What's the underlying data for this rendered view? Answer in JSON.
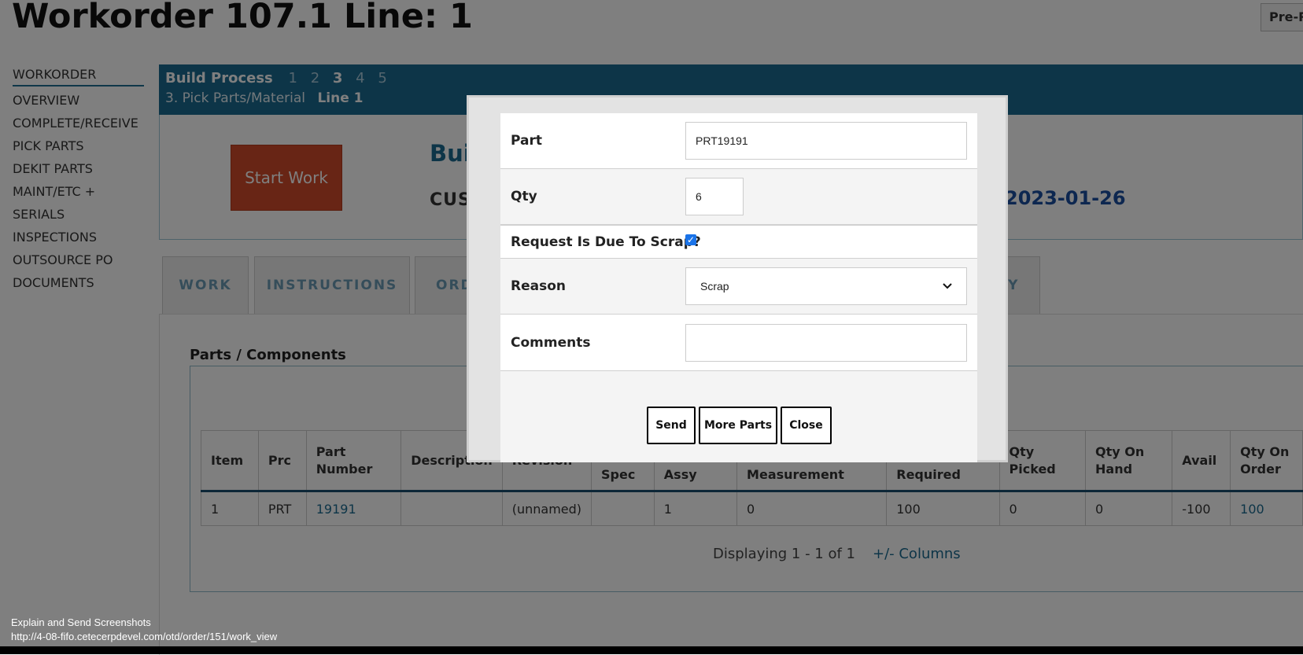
{
  "page": {
    "title": "Workorder 107.1 Line: 1",
    "pre_button": "Pre-Re"
  },
  "sidenav": [
    "WORKORDER",
    "OVERVIEW",
    "COMPLETE/RECEIVE",
    "PICK PARTS",
    "DEKIT PARTS",
    "MAINT/ETC +",
    "SERIALS",
    "INSPECTIONS",
    "OUTSOURCE PO",
    "DOCUMENTS"
  ],
  "banner": {
    "build_process": "Build Process",
    "steps": [
      "1",
      "2",
      "3",
      "4",
      "5"
    ],
    "current_step": "3",
    "step_label": "3. Pick Parts/Material",
    "line": "Line 1"
  },
  "header": {
    "start_button": "Start Work",
    "build_title": "Buil",
    "customer_label": "CUS",
    "due_date": "2023-01-26"
  },
  "tabs": [
    "WORK",
    "INSTRUCTIONS",
    "ORD",
    "RY"
  ],
  "parts": {
    "title": "Parts / Components",
    "columns": [
      "Item",
      "Prc",
      "Part Number",
      "Description",
      "Revision",
      "Spec",
      "Assy",
      "Measurement",
      "Required",
      "Qty Picked",
      "Qty On Hand",
      "Avail",
      "Qty On Order"
    ],
    "rows": [
      {
        "item": "1",
        "prc": "PRT",
        "part_number": "19191",
        "description": "",
        "revision": "(unnamed)",
        "spec": "",
        "assy": "1",
        "measurement": "0",
        "required": "100",
        "qty_picked": "0",
        "qty_on_hand": "0",
        "avail": "-100",
        "qty_on_order": "100"
      }
    ],
    "display_info": "Displaying 1 - 1 of 1",
    "columns_link": "+/- Columns"
  },
  "modal": {
    "part_label": "Part",
    "part_value": "PRT19191",
    "qty_label": "Qty",
    "qty_value": "6",
    "scrap_label": "Request Is Due To Scrap?",
    "scrap_checked": true,
    "reason_label": "Reason",
    "reason_value": "Scrap",
    "comments_label": "Comments",
    "comments_value": "",
    "send_button": "Send",
    "more_parts_button": "More Parts",
    "close_button": "Close"
  },
  "statusbar": {
    "line1": "Explain and Send Screenshots",
    "line2": "http://4-08-fifo.cetecerpdevel.com/otd/order/151/work_view"
  }
}
